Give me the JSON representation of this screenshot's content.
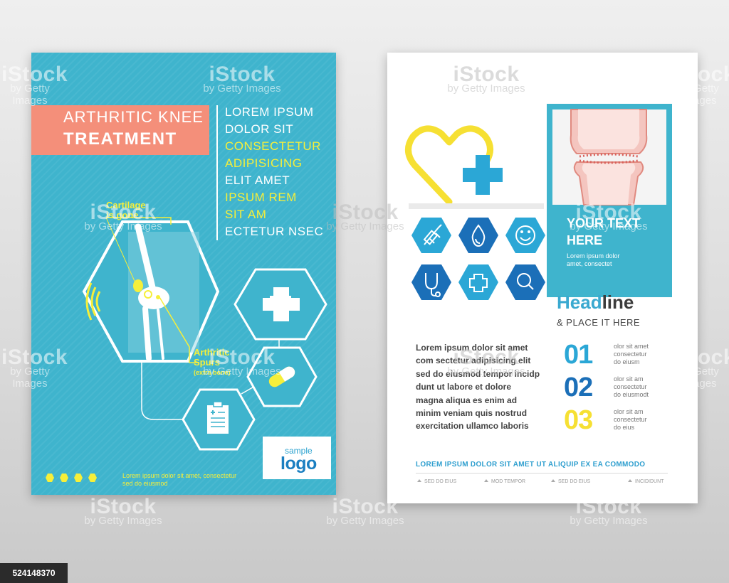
{
  "left_flyer": {
    "title_line1": "ARTHRITIC KNEE",
    "title_line2": "TREATMENT",
    "lorem_lines": [
      {
        "text": "LOREM IPSUM",
        "color": "white"
      },
      {
        "text": "DOLOR SIT",
        "color": "white"
      },
      {
        "text": "CONSECTETUR",
        "color": "yellow"
      },
      {
        "text": "ADIPISICING",
        "color": "yellow"
      },
      {
        "text": "ELIT AMET",
        "color": "white"
      },
      {
        "text": "IPSUM REM",
        "color": "yellow"
      },
      {
        "text": "SIT AM",
        "color": "yellow"
      },
      {
        "text": "ECTETUR NSEC",
        "color": "white"
      }
    ],
    "annotation_cartilage_1": "Cartilage",
    "annotation_cartilage_2": "is gone",
    "annotation_spurs_1": "Arthritic",
    "annotation_spurs_2": "Spurs",
    "annotation_spurs_3": "(extra bone)",
    "footer_line1": "Lorem ipsum dolor sit amet, consectetur",
    "footer_line2": "sed do eiusmod",
    "logo_sample": "sample",
    "logo_text": "logo",
    "colors": {
      "background": "#3fb4cd",
      "accent": "#f48f7a",
      "highlight": "#f6ef3a"
    }
  },
  "right_flyer": {
    "your_text_1": "YOUR TEXT",
    "your_text_2": "HERE",
    "your_sub_1": "Lorem ipsum dolor",
    "your_sub_2": "amet, consectet",
    "headline_blue": "Head",
    "headline_dark": "line",
    "place": "& PLACE IT HERE",
    "body_lines": [
      "Lorem ipsum dolor sit amet",
      "com sectetur adipisicing elit",
      "sed do eiusmod tempor incidp",
      "dunt ut labore et dolore",
      "magna aliqua es enim ad",
      "minim veniam quis nostrud",
      "exercitation ullamco laboris"
    ],
    "numbers": [
      {
        "n": "01",
        "color": "#2ba7d6",
        "l1": "olor sit amet",
        "l2": "consectetur",
        "l3": "do eiusm"
      },
      {
        "n": "02",
        "color": "#1b6fb8",
        "l1": "olor sit am",
        "l2": "consectetur",
        "l3": "do eiusmodt"
      },
      {
        "n": "03",
        "color": "#f6e033",
        "l1": "olor sit am",
        "l2": "consectetur",
        "l3": "do eius"
      }
    ],
    "bottom_banner": "LOREM IPSUM DOLOR SIT AMET UT ALIQUIP EX EA COMMODO",
    "bottom_tags": [
      "SED DO EIUS",
      "MOD TEMPOR",
      "SED DO EIUS",
      "INCIDIDUNT"
    ],
    "icons": [
      "syringe-icon",
      "drop-icon",
      "smiley-icon",
      "stethoscope-icon",
      "cross-icon",
      "magnifier-icon"
    ]
  },
  "watermark": {
    "brand": "iStock",
    "by": "by Getty Images"
  },
  "stock_id": "524148370"
}
